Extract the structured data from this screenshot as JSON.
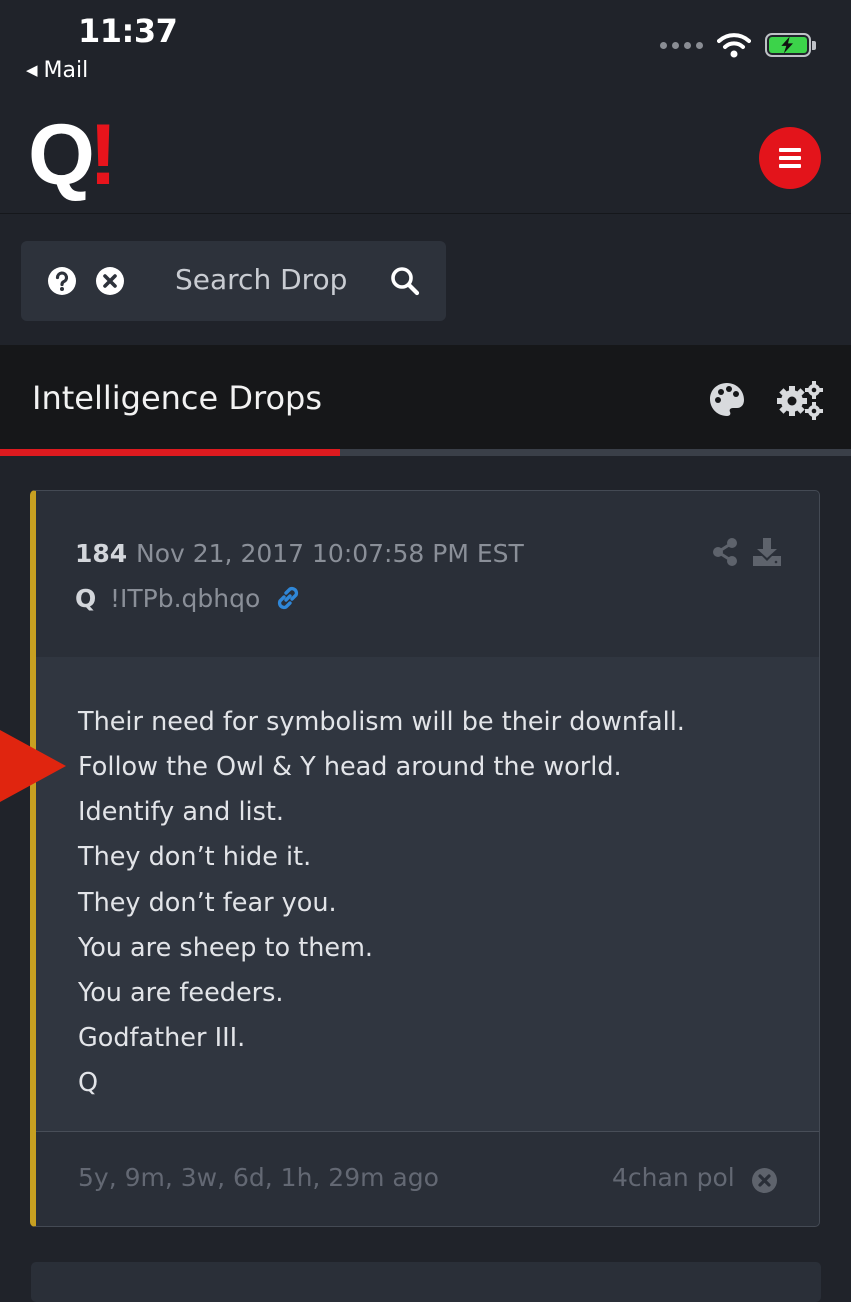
{
  "status_bar": {
    "time": "11:37",
    "back_label": "Mail",
    "icons": [
      "cellular-dots-icon",
      "wifi-icon",
      "battery-charging-icon"
    ]
  },
  "header": {
    "logo_letter": "Q",
    "logo_mark": "!",
    "menu_icon": "hamburger-menu-icon"
  },
  "search": {
    "placeholder": "Search Drop",
    "icons": [
      "help-icon",
      "clear-icon",
      "search-icon"
    ]
  },
  "section": {
    "title": "Intelligence Drops",
    "icons": [
      "palette-icon",
      "settings-gears-icon"
    ],
    "progress_fraction": 0.4
  },
  "drop": {
    "number": "184",
    "date": "Nov 21, 2017 10:07:58 PM EST",
    "author": "Q",
    "tripcode": "!ITPb.qbhqo",
    "lines": [
      "Their need for symbolism will be their downfall.",
      "Follow the Owl & Y head around the world.",
      "Identify and list.",
      "They don’t hide it.",
      "They don’t fear you.",
      "You are sheep to them.",
      "You are feeders.",
      "Godfather III.",
      "Q"
    ],
    "time_ago": "5y, 9m, 3w, 6d, 1h, 29m ago",
    "source": "4chan pol"
  },
  "colors": {
    "background": "#20232a",
    "accent_red": "#e3141b",
    "card_border_gold": "#c7a021",
    "link_blue": "#2f87d8"
  }
}
